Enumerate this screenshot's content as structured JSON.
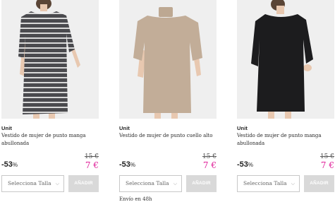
{
  "products": [
    {
      "brand": "Unit",
      "title": "Vestido de mujer de punto manga abullonada",
      "old_price": "15 €",
      "discount": "-53",
      "discount_pct": "%",
      "price": "7 €",
      "size_placeholder": "Selecciona Talla",
      "add_label": "AÑADIR",
      "dress_color": "#4a4a4e",
      "stripe_color": "#d9d9d9"
    },
    {
      "brand": "Unit",
      "title": "Vestido de mujer de punto cuello alto",
      "old_price": "15 €",
      "discount": "-53",
      "discount_pct": "%",
      "price": "7 €",
      "size_placeholder": "Selecciona Talla",
      "add_label": "AÑADIR",
      "shipping": "Envío en 48h",
      "dress_color": "#c2ad98"
    },
    {
      "brand": "Unit",
      "title": "Vestido de mujer de punto manga abullonada",
      "old_price": "15 €",
      "discount": "-53",
      "discount_pct": "%",
      "price": "7 €",
      "size_placeholder": "Selecciona Talla",
      "add_label": "AÑADIR",
      "dress_color": "#1c1c1e"
    }
  ],
  "colors": {
    "price_accent": "#e0229a",
    "button_disabled": "#d9d9d9",
    "image_background": "#efefef"
  }
}
